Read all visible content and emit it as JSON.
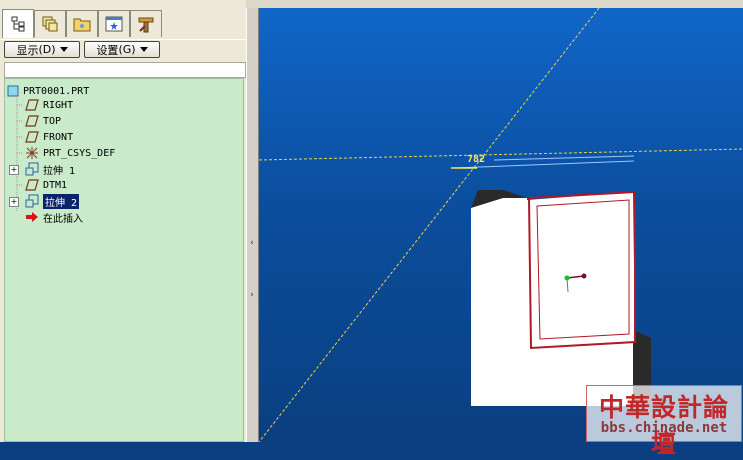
{
  "toolbar": {
    "show_button": "显示",
    "show_key": "(D)",
    "settings_button": "设置",
    "settings_key": "(G)"
  },
  "tabs": [
    {
      "name": "model-tree-icon",
      "active": true
    },
    {
      "name": "layers-icon",
      "active": false
    },
    {
      "name": "folder-icon",
      "active": false
    },
    {
      "name": "favorites-icon",
      "active": false
    },
    {
      "name": "tools-icon",
      "active": false
    }
  ],
  "tree": {
    "root": "PRT0001.PRT",
    "items": [
      {
        "label": "RIGHT",
        "icon": "datum-plane-icon",
        "expandable": false
      },
      {
        "label": "TOP",
        "icon": "datum-plane-icon",
        "expandable": false
      },
      {
        "label": "FRONT",
        "icon": "datum-plane-icon",
        "expandable": false
      },
      {
        "label": "PRT_CSYS_DEF",
        "icon": "csys-icon",
        "expandable": false
      },
      {
        "label": "拉伸 1",
        "icon": "extrude-icon",
        "expandable": true
      },
      {
        "label": "DTM1",
        "icon": "datum-plane-icon",
        "expandable": false
      },
      {
        "label": "拉伸 2",
        "icon": "extrude-icon",
        "expandable": true,
        "selected": true
      },
      {
        "label": "在此插入",
        "icon": "insert-here-icon",
        "expandable": false
      }
    ]
  },
  "viewport": {
    "dim_text": "782"
  },
  "watermark": {
    "line1": "中華設計論壇",
    "line2": "bbs.chinade.net"
  },
  "colors": {
    "tree_bg": "#c9ebc9",
    "viewport_top": "#1066c8",
    "viewport_bottom": "#0a3f7f",
    "selection": "#0a246a",
    "datum_line": "#e8d24a",
    "sketch_outline": "#b01824"
  }
}
